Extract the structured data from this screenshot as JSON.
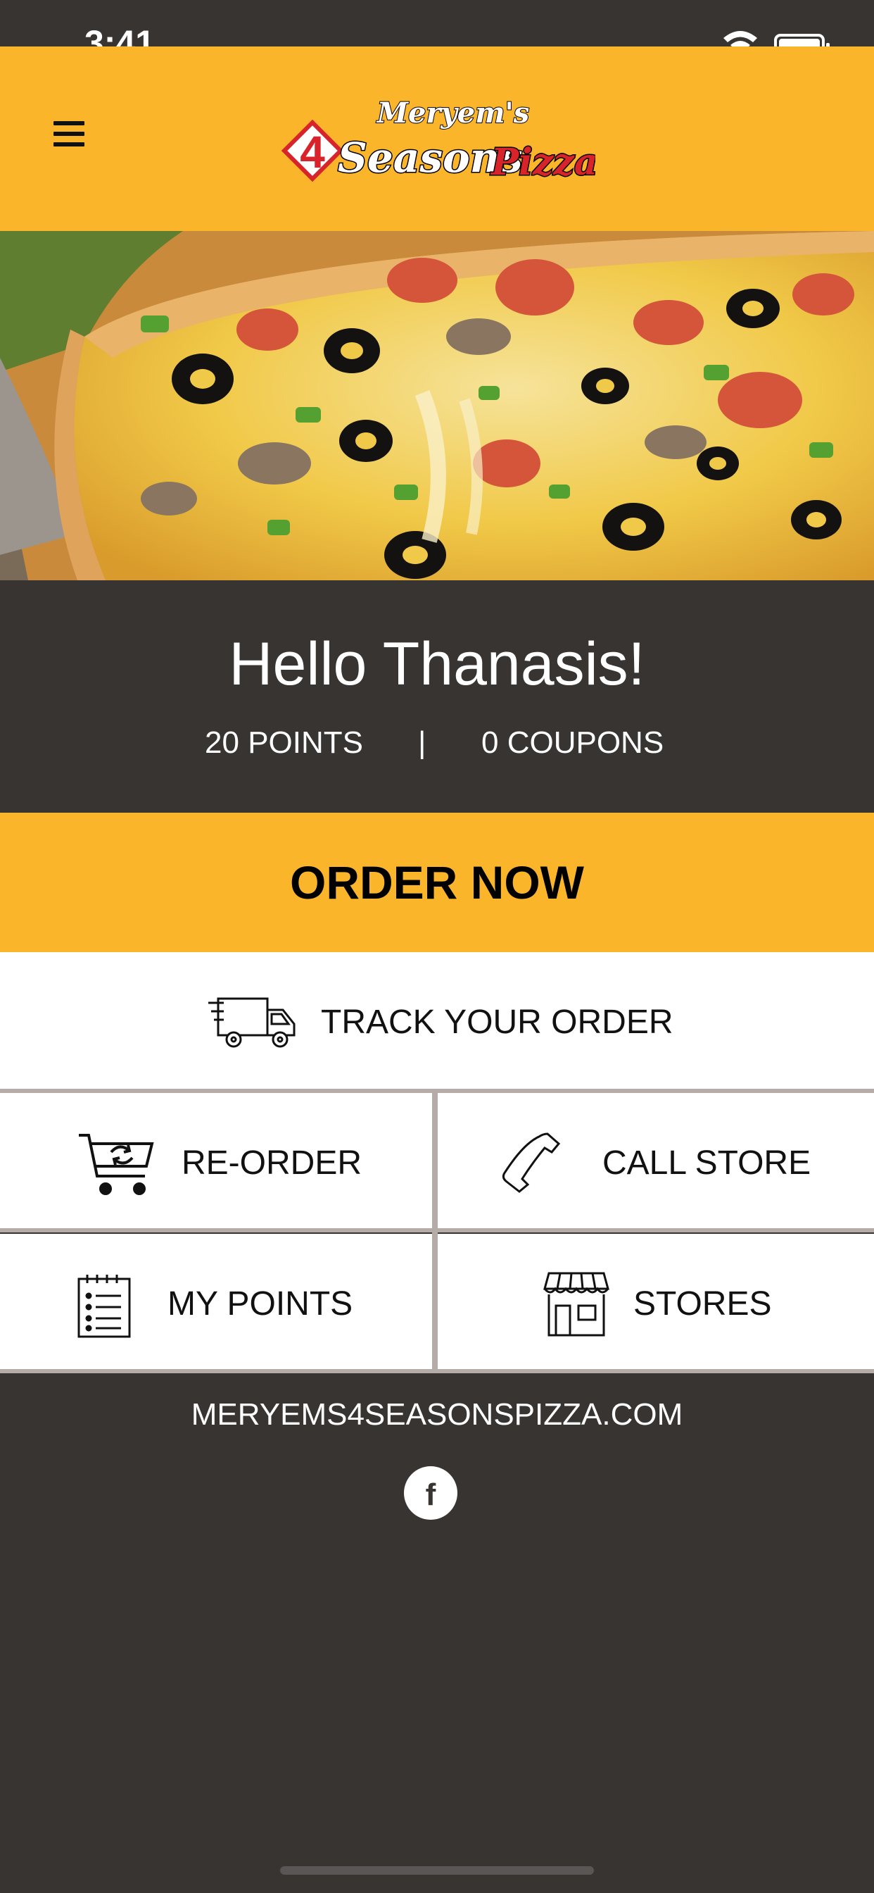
{
  "status_bar": {
    "time": "3:41"
  },
  "header": {
    "logo": {
      "top_text": "Meryem's",
      "badge": "4",
      "main_text": "Seasons",
      "accent_text": "Pizza"
    }
  },
  "greeting": {
    "hello": "Hello Thanasis!",
    "points": "20 POINTS",
    "separator": "|",
    "coupons": "0 COUPONS"
  },
  "actions": {
    "order_now": "ORDER NOW",
    "track_order": "TRACK YOUR ORDER",
    "reorder": "RE-ORDER",
    "call_store": "CALL STORE",
    "my_points": "MY POINTS",
    "stores": "STORES"
  },
  "footer": {
    "website": "MERYEMS4SEASONSPIZZA.COM",
    "social_icon": "f"
  },
  "colors": {
    "brand_yellow": "#fbb52b",
    "dark_bg": "#383432",
    "divider": "#b5aca7",
    "logo_red": "#d8232a"
  },
  "icons": [
    "menu-icon",
    "delivery-truck-icon",
    "cart-reorder-icon",
    "phone-icon",
    "checklist-icon",
    "storefront-icon",
    "facebook-icon"
  ]
}
